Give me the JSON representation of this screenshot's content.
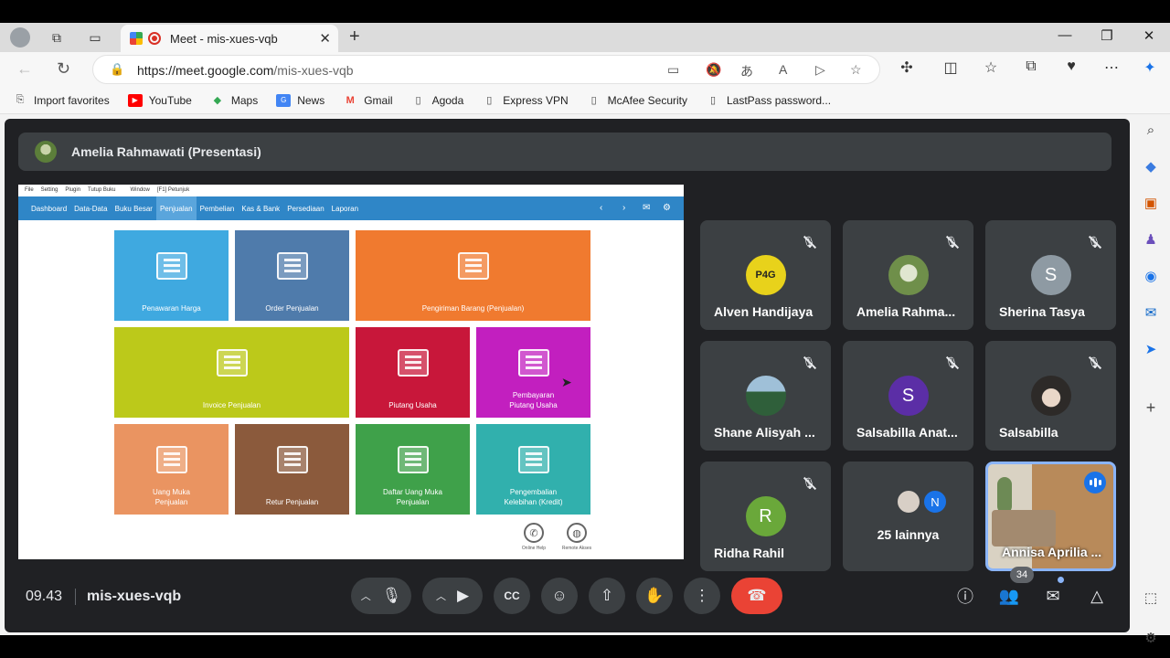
{
  "browser": {
    "tab_title": "Meet - mis-xues-vqb",
    "url_host": "https://meet.google.com",
    "url_path": "/mis-xues-vqb"
  },
  "bookmarks": [
    {
      "label": "Import favorites",
      "icon": "import-icon"
    },
    {
      "label": "YouTube",
      "icon": "youtube-icon"
    },
    {
      "label": "Maps",
      "icon": "maps-icon"
    },
    {
      "label": "News",
      "icon": "news-icon"
    },
    {
      "label": "Gmail",
      "icon": "gmail-icon"
    },
    {
      "label": "Agoda",
      "icon": "page-icon"
    },
    {
      "label": "Express VPN",
      "icon": "page-icon"
    },
    {
      "label": "McAfee Security",
      "icon": "page-icon"
    },
    {
      "label": "LastPass password...",
      "icon": "page-icon"
    }
  ],
  "meet": {
    "presenter_label": "Amelia Rahmawati (Presentasi)",
    "time": "09.43",
    "meeting_code": "mis-xues-vqb",
    "participant_count": "34",
    "participants": [
      {
        "name": "Alven Handijaya",
        "avatar": "photo",
        "color": "#e8d21b",
        "muted": true
      },
      {
        "name": "Amelia Rahma...",
        "avatar": "photo",
        "color": "#6f8f4a",
        "muted": true
      },
      {
        "name": "Sherina Tasya",
        "avatar": "S",
        "color": "#8e9aa3",
        "muted": true
      },
      {
        "name": "Shane Alisyah ...",
        "avatar": "photo",
        "color": "#4f6d84",
        "muted": true
      },
      {
        "name": "Salsabilla Anat...",
        "avatar": "S",
        "color": "#5b2ea6",
        "muted": true
      },
      {
        "name": "Salsabilla",
        "avatar": "photo",
        "color": "#cfc7c0",
        "muted": true
      },
      {
        "name": "Ridha Rahil",
        "avatar": "R",
        "color": "#6aa83a",
        "muted": true
      },
      {
        "name": "25 lainnya",
        "avatar": "N",
        "color": "#1a73e8",
        "muted": false
      },
      {
        "name": "Annisa Aprilia ...",
        "avatar": "video",
        "color": "#8ab4f8",
        "muted": false
      }
    ]
  },
  "shared_app": {
    "menu": [
      "File",
      "Setting",
      "Plugin",
      "Tutup Buku",
      "Window",
      "[F1] Petunjuk"
    ],
    "nav": [
      "Dashboard",
      "Data-Data",
      "Buku Besar",
      "Penjualan",
      "Pembelian",
      "Kas & Bank",
      "Persediaan",
      "Laporan"
    ],
    "active_nav": "Penjualan",
    "tiles": [
      {
        "label": "Penawaran Harga",
        "color": "#3fa9e0"
      },
      {
        "label": "Order Penjualan",
        "color": "#4f7bab"
      },
      {
        "label": "Pengiriman Barang (Penjualan)",
        "color": "#f07a2f"
      },
      {
        "label": "Invoice Penjualan",
        "color": "#bcc91a"
      },
      {
        "label": "Piutang Usaha",
        "color": "#c8173a"
      },
      {
        "label": "Pembayaran\nPiutang Usaha",
        "color": "#c21fbf"
      },
      {
        "label": "Uang Muka\nPenjualan",
        "color": "#ea9461"
      },
      {
        "label": "Retur Penjualan",
        "color": "#8b5a3c"
      },
      {
        "label": "Daftar Uang Muka\nPenjualan",
        "color": "#3fa14a"
      },
      {
        "label": "Pengembalian\nKelebihan (Kredit)",
        "color": "#31b0ad"
      }
    ],
    "help": [
      "Online Help",
      "Remote Akses"
    ]
  }
}
